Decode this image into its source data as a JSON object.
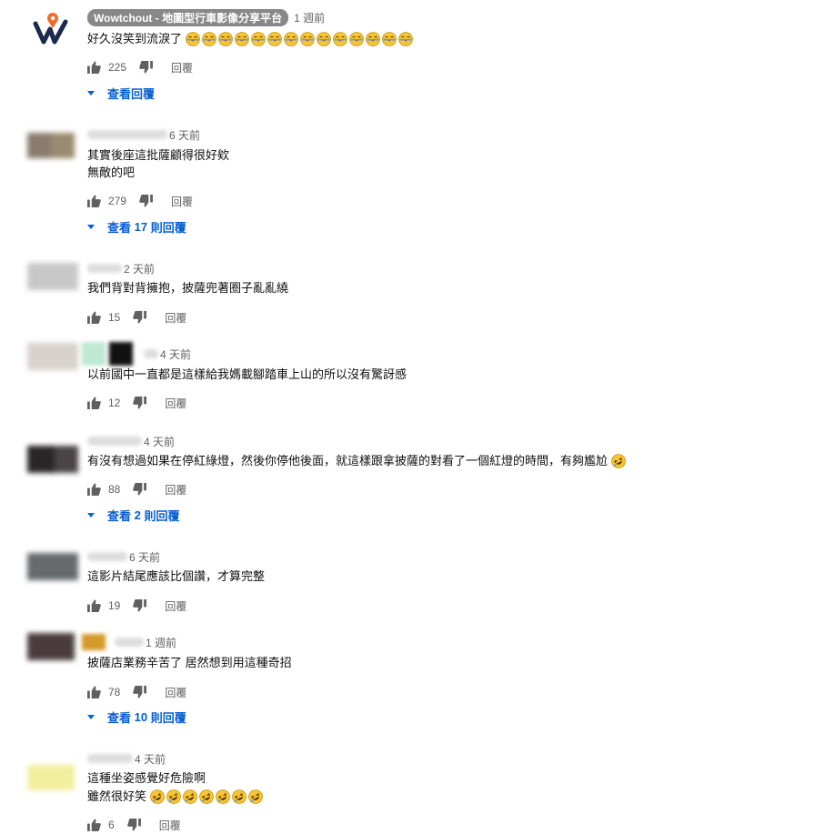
{
  "labels": {
    "reply": "回覆"
  },
  "colors": {
    "link": "#065fd4",
    "meta": "#606060",
    "text": "#0f0f0f",
    "author_chip": "#888888"
  },
  "comments": [
    {
      "author": "Wowtchout - 地圖型行車影像分享平台",
      "time": "1 週前",
      "lines": [
        "好久沒笑到流淚了"
      ],
      "emoji": "joy-emoji",
      "emoji_count": 14,
      "likes": "225",
      "replies_label": "查看回覆"
    },
    {
      "author": "",
      "time": "6 天前",
      "lines": [
        "其實後座這批薩顧得很好欸",
        "無敵的吧"
      ],
      "likes": "279",
      "replies_prefix": "查看",
      "replies_count": "17",
      "replies_suffix": "則回覆"
    },
    {
      "author": "",
      "time": "2 天前",
      "lines": [
        "我們背對背擁抱，披薩兜著圈子亂亂繞"
      ],
      "likes": "15"
    },
    {
      "author": "",
      "time": "4 天前",
      "lines": [
        "以前國中一直都是這樣給我媽載腳踏車上山的所以沒有驚訝感"
      ],
      "likes": "12"
    },
    {
      "author": "",
      "time": "4 天前",
      "lines": [
        "有沒有想過如果在停紅綠燈，然後你停他後面，就這樣跟拿披薩的對看了一個紅燈的時間，有夠尷尬"
      ],
      "emoji": "rofl-emoji",
      "emoji_count": 1,
      "likes": "88",
      "replies_prefix": "查看",
      "replies_count": "2",
      "replies_suffix": "則回覆"
    },
    {
      "author": "",
      "time": "6 天前",
      "lines": [
        "這影片結尾應該比個讚，才算完整"
      ],
      "likes": "19"
    },
    {
      "author": "",
      "time": "1 週前",
      "lines": [
        "披薩店業務辛苦了 居然想到用這種奇招"
      ],
      "likes": "78",
      "replies_prefix": "查看",
      "replies_count": "10",
      "replies_suffix": "則回覆"
    },
    {
      "author": "",
      "time": "4 天前",
      "lines": [
        "這種坐姿感覺好危險啊",
        "雖然很好笑"
      ],
      "emoji": "rofl-emoji",
      "emoji_count": 7,
      "likes": "6"
    }
  ]
}
